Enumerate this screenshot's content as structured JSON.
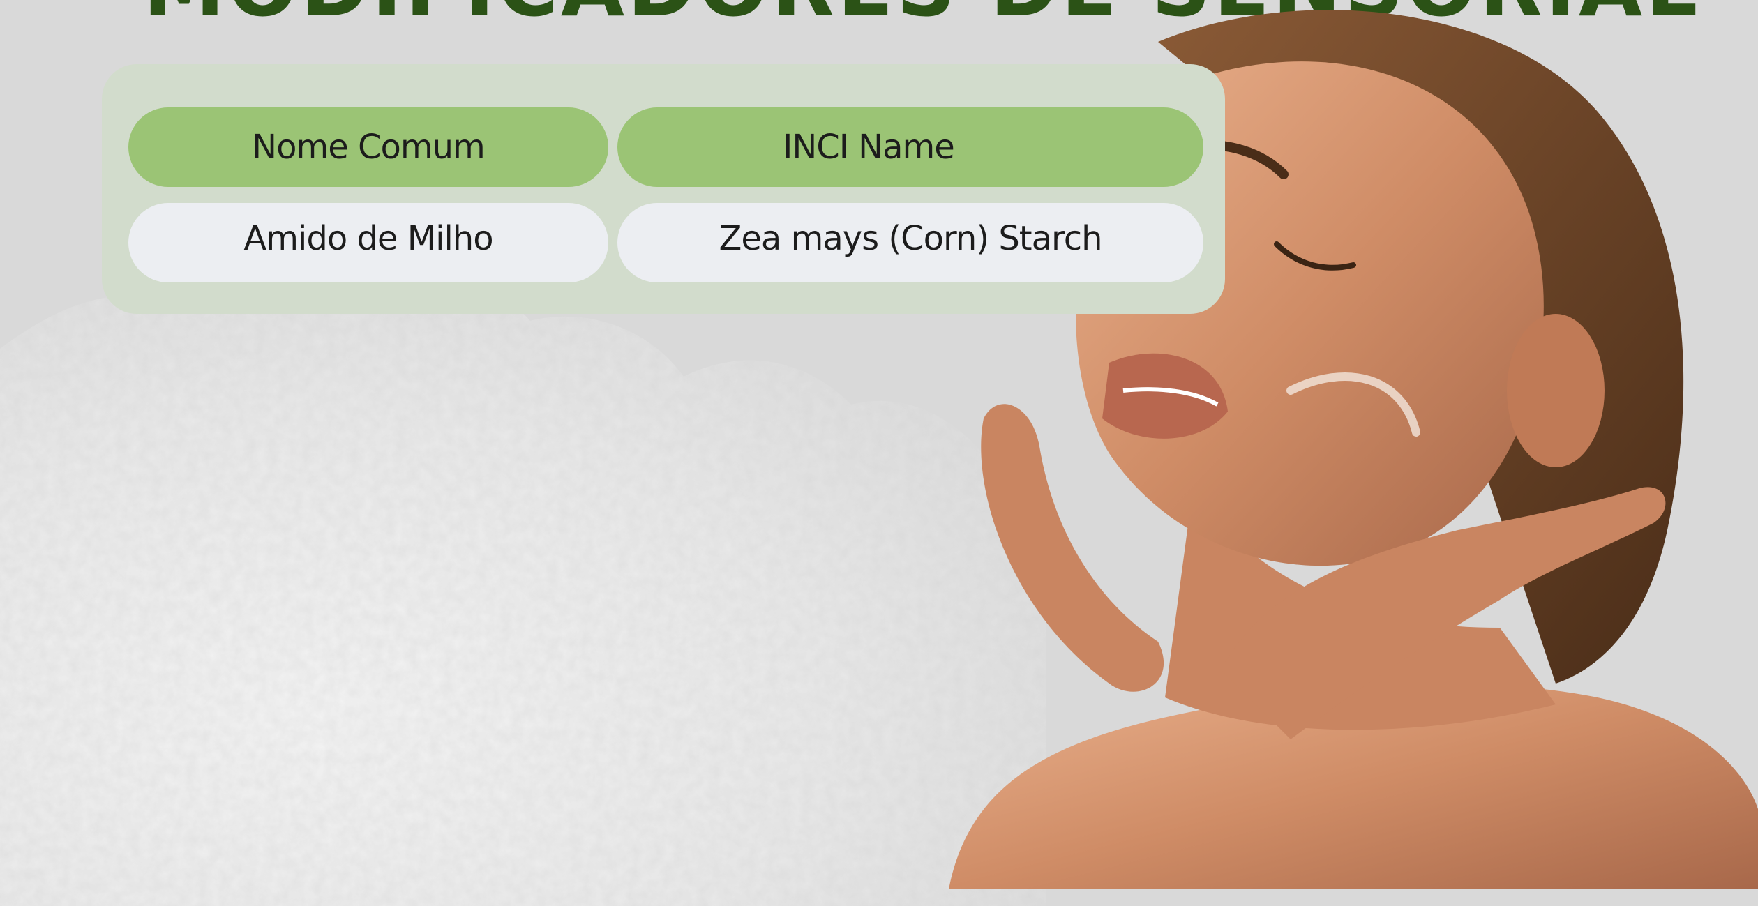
{
  "page": {
    "title": "MODIFICADORES DE SENSORIAL"
  },
  "table": {
    "headers": [
      "Nome Comum",
      "INCI Name"
    ],
    "rows": [
      [
        "Amido de Milho",
        "Zea mays (Corn) Starch"
      ]
    ]
  },
  "colors": {
    "background": "#d9d9d9",
    "title": "#2b5216",
    "panel": "#d2dccc",
    "header_cell": "#9bc475",
    "body_cell": "#eceef2"
  },
  "images": {
    "powder": "white-powder-illustration",
    "photo": "woman-applying-cream-photo"
  }
}
